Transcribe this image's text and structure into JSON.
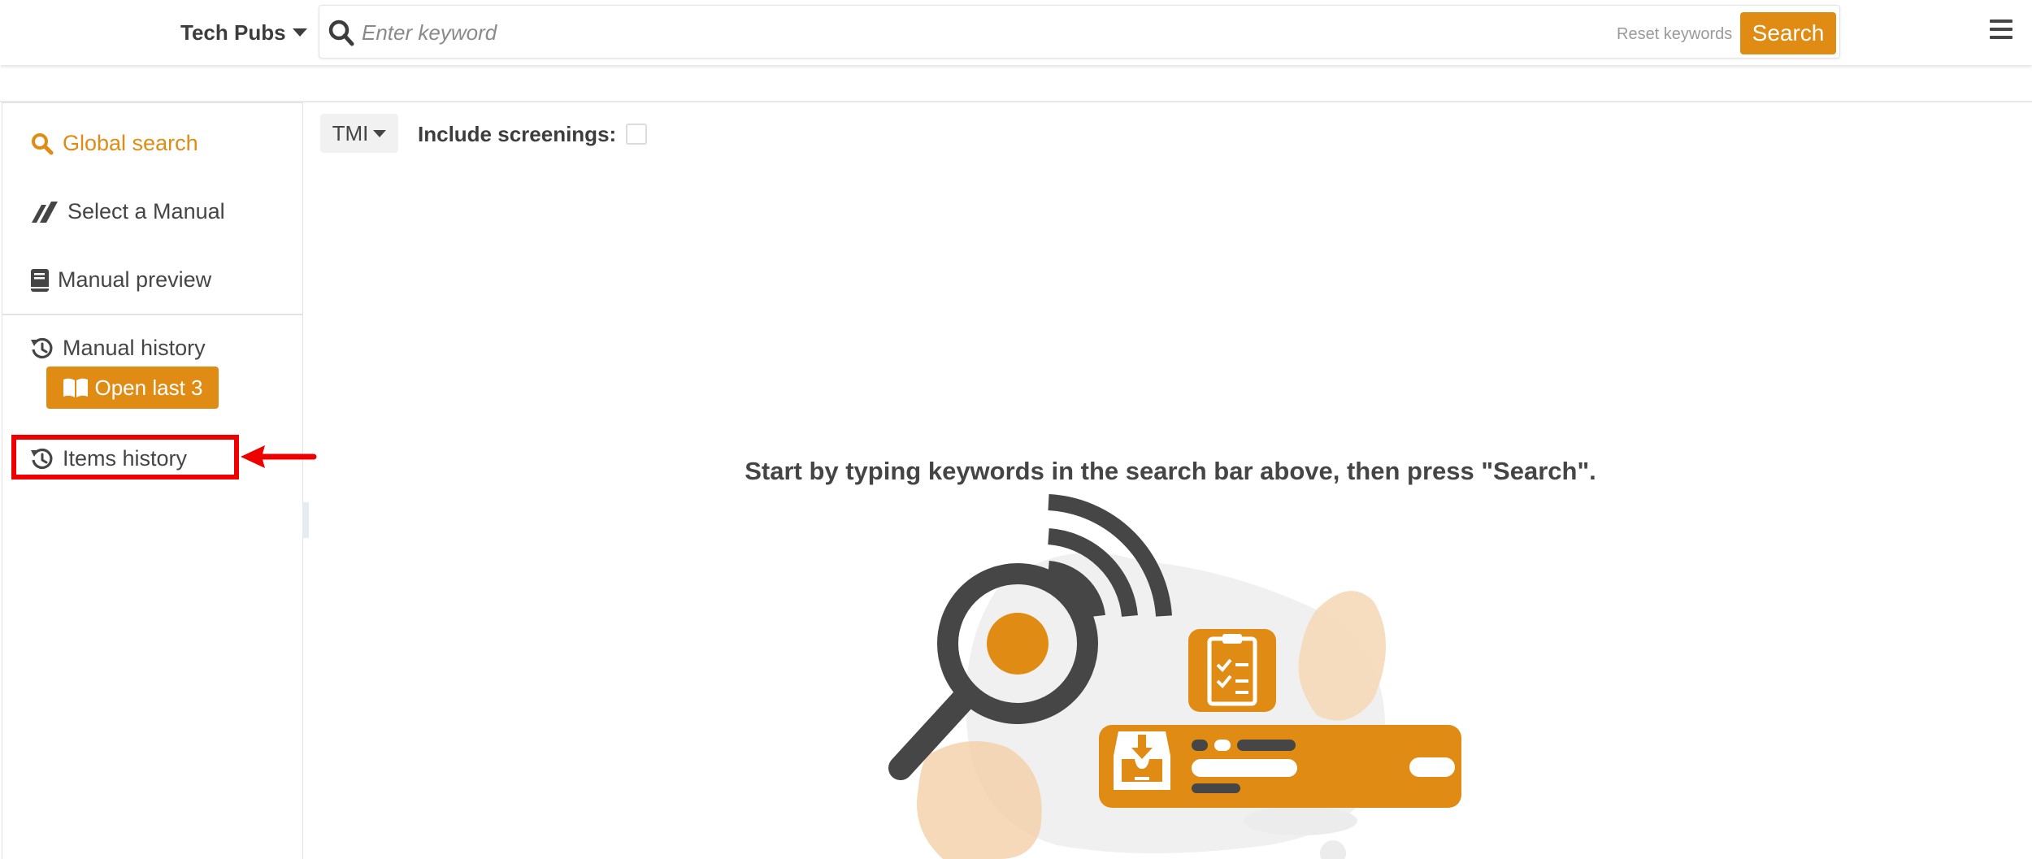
{
  "header": {
    "product_name": "Tech Pubs",
    "search_placeholder": "Enter keyword",
    "reset_label": "Reset keywords",
    "search_button": "Search"
  },
  "sidebar": {
    "items": [
      {
        "label": "Global search",
        "icon": "search-icon",
        "active": true
      },
      {
        "label": "Select a Manual",
        "icon": "manual-select-icon",
        "active": false
      },
      {
        "label": "Manual preview",
        "icon": "book-icon",
        "active": false
      },
      {
        "label": "Manual history",
        "icon": "history-icon",
        "active": false
      },
      {
        "label": "Items history",
        "icon": "history-icon",
        "active": false
      }
    ],
    "open_last_button": "Open last 3"
  },
  "main": {
    "filter_dropdown": "TMI",
    "include_screenings_label": "Include screenings:",
    "include_screenings_checked": false,
    "prompt": "Start by typing keywords in the search bar above, then press \"Search\"."
  },
  "colors": {
    "accent": "#e08c14",
    "text": "#454545",
    "annotation": "#ee0000"
  }
}
